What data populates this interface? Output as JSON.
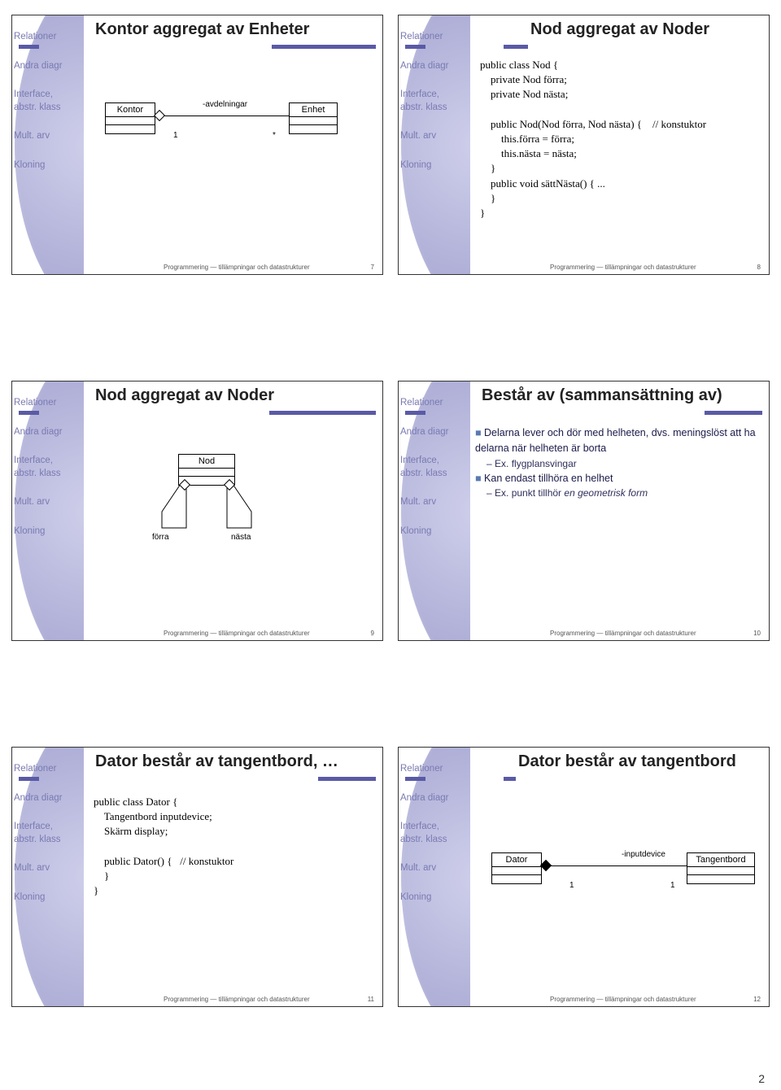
{
  "sidebar": {
    "items": [
      "Relationer",
      "Andra diagr",
      "Interface,\nabstr. klass",
      "Mult. arv",
      "Kloning"
    ]
  },
  "footer": {
    "text": "Programmering — tillämpningar och datastrukturer"
  },
  "page_number": "2",
  "slides": [
    {
      "title": "Kontor aggregat av Enheter",
      "number": "7",
      "uml": {
        "left_class": "Kontor",
        "right_class": "Enhet",
        "assoc_label": "-avdelningar",
        "left_mult": "1",
        "right_mult": "*"
      }
    },
    {
      "title": "Nod aggregat av Noder",
      "number": "8",
      "code": "public class Nod {\n    private Nod förra;\n    private Nod nästa;\n\n    public Nod(Nod förra, Nod nästa) {    // konstuktor\n        this.förra = förra;\n        this.nästa = nästa;\n    }\n    public void sättNästa() { ...\n    }\n}"
    },
    {
      "title": "Nod aggregat av Noder",
      "number": "9",
      "uml2": {
        "class_name": "Nod",
        "left_role": "förra",
        "right_role": "nästa"
      }
    },
    {
      "title": "Består av (sammansättning av)",
      "number": "10",
      "bullets": [
        {
          "level": 1,
          "text": "Delarna lever och dör med helheten, dvs. meningslöst att ha delarna när helheten är borta"
        },
        {
          "level": 2,
          "text": "Ex. flygplansvingar"
        },
        {
          "level": 1,
          "text": "Kan endast tillhöra en helhet"
        },
        {
          "level": 2,
          "text": "Ex. punkt tillhör ",
          "italic_tail": "en geometrisk form"
        }
      ]
    },
    {
      "title": "Dator består av tangentbord, …",
      "number": "11",
      "code": "public class Dator {\n    Tangentbord inputdevice;\n    Skärm display;\n\n    public Dator() {   // konstuktor\n    }\n}"
    },
    {
      "title": "Dator består av tangentbord",
      "number": "12",
      "uml3": {
        "left_class": "Dator",
        "right_class": "Tangentbord",
        "assoc_label": "-inputdevice",
        "left_mult": "1",
        "right_mult": "1"
      }
    }
  ]
}
